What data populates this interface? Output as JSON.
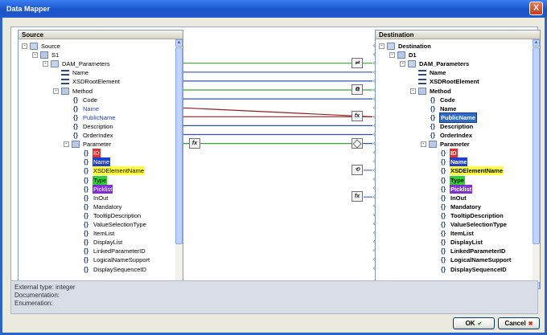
{
  "window": {
    "title": "Data Mapper",
    "close_glyph": "X"
  },
  "source": {
    "header": "Source",
    "nodes": [
      {
        "label": "Source",
        "level": 0,
        "icon": "folder-icon",
        "expander": "-"
      },
      {
        "label": "S1",
        "level": 1,
        "icon": "document-icon",
        "expander": "-"
      },
      {
        "label": "DAM_Parameters",
        "level": 2,
        "icon": "folder-icon",
        "expander": "-"
      },
      {
        "label": "Name",
        "level": 3,
        "icon": "field-icon",
        "expander": ""
      },
      {
        "label": "XSDRootElement",
        "level": 3,
        "icon": "field-icon",
        "expander": ""
      },
      {
        "label": "Method",
        "level": 3,
        "icon": "document-icon",
        "expander": "-"
      },
      {
        "label": "Code",
        "level": 4,
        "icon": "brace-icon",
        "expander": ""
      },
      {
        "label": "Name",
        "level": 4,
        "icon": "brace-icon",
        "expander": "",
        "style": "c-blue"
      },
      {
        "label": "PublicName",
        "level": 4,
        "icon": "brace-icon",
        "expander": "",
        "style": "c-blue"
      },
      {
        "label": "Description",
        "level": 4,
        "icon": "brace-icon",
        "expander": ""
      },
      {
        "label": "OrderIndex",
        "level": 4,
        "icon": "brace-icon",
        "expander": ""
      },
      {
        "label": "Parameter",
        "level": 4,
        "icon": "document-icon",
        "expander": "-"
      },
      {
        "label": "ID",
        "level": 5,
        "icon": "brace-icon",
        "expander": "",
        "style": "hl-red"
      },
      {
        "label": "Name",
        "level": 5,
        "icon": "brace-icon",
        "expander": "",
        "style": "hl-blue"
      },
      {
        "label": "XSDElementName",
        "level": 5,
        "icon": "brace-icon",
        "expander": "",
        "style": "hl-yellow"
      },
      {
        "label": "Type",
        "level": 5,
        "icon": "brace-icon",
        "expander": "",
        "style": "hl-green"
      },
      {
        "label": "Picklist",
        "level": 5,
        "icon": "brace-icon",
        "expander": "",
        "style": "hl-purple"
      },
      {
        "label": "InOut",
        "level": 5,
        "icon": "brace-icon",
        "expander": ""
      },
      {
        "label": "Mandatory",
        "level": 5,
        "icon": "brace-icon",
        "expander": ""
      },
      {
        "label": "TooltipDescription",
        "level": 5,
        "icon": "brace-icon",
        "expander": ""
      },
      {
        "label": "ValueSelectionType",
        "level": 5,
        "icon": "brace-icon",
        "expander": ""
      },
      {
        "label": "ItemList",
        "level": 5,
        "icon": "brace-icon",
        "expander": ""
      },
      {
        "label": "DisplayList",
        "level": 5,
        "icon": "brace-icon",
        "expander": ""
      },
      {
        "label": "LinkedParameterID",
        "level": 5,
        "icon": "brace-icon",
        "expander": ""
      },
      {
        "label": "LogicalNameSupport",
        "level": 5,
        "icon": "brace-icon",
        "expander": ""
      },
      {
        "label": "DisplaySequenceID",
        "level": 5,
        "icon": "brace-icon",
        "expander": ""
      }
    ]
  },
  "destination": {
    "header": "Destination",
    "nodes": [
      {
        "label": "Destination",
        "level": 0,
        "icon": "folder-icon",
        "expander": "-"
      },
      {
        "label": "D1",
        "level": 1,
        "icon": "document-icon",
        "expander": "-"
      },
      {
        "label": "DAM_Parameters",
        "level": 2,
        "icon": "folder-icon",
        "expander": "-"
      },
      {
        "label": "Name",
        "level": 3,
        "icon": "field-icon",
        "expander": ""
      },
      {
        "label": "XSDRootElement",
        "level": 3,
        "icon": "field-icon",
        "expander": ""
      },
      {
        "label": "Method",
        "level": 3,
        "icon": "document-icon",
        "expander": "-"
      },
      {
        "label": "Code",
        "level": 4,
        "icon": "brace-icon",
        "expander": ""
      },
      {
        "label": "Name",
        "level": 4,
        "icon": "brace-icon",
        "expander": ""
      },
      {
        "label": "PublicName",
        "level": 4,
        "icon": "brace-icon",
        "expander": "",
        "style": "hl-sel"
      },
      {
        "label": "Description",
        "level": 4,
        "icon": "brace-icon",
        "expander": ""
      },
      {
        "label": "OrderIndex",
        "level": 4,
        "icon": "brace-icon",
        "expander": ""
      },
      {
        "label": "Parameter",
        "level": 4,
        "icon": "document-icon",
        "expander": "-"
      },
      {
        "label": "ID",
        "level": 5,
        "icon": "brace-icon",
        "expander": "",
        "style": "hl-red"
      },
      {
        "label": "Name",
        "level": 5,
        "icon": "brace-icon",
        "expander": "",
        "style": "hl-blue"
      },
      {
        "label": "XSDElementName",
        "level": 5,
        "icon": "brace-icon",
        "expander": "",
        "style": "hl-yellow"
      },
      {
        "label": "Type",
        "level": 5,
        "icon": "brace-icon",
        "expander": "",
        "style": "hl-green"
      },
      {
        "label": "Picklist",
        "level": 5,
        "icon": "brace-icon",
        "expander": "",
        "style": "hl-purple"
      },
      {
        "label": "InOut",
        "level": 5,
        "icon": "brace-icon",
        "expander": ""
      },
      {
        "label": "Mandatory",
        "level": 5,
        "icon": "brace-icon",
        "expander": ""
      },
      {
        "label": "TooltipDescription",
        "level": 5,
        "icon": "brace-icon",
        "expander": ""
      },
      {
        "label": "ValueSelectionType",
        "level": 5,
        "icon": "brace-icon",
        "expander": ""
      },
      {
        "label": "ItemList",
        "level": 5,
        "icon": "brace-icon",
        "expander": ""
      },
      {
        "label": "DisplayList",
        "level": 5,
        "icon": "brace-icon",
        "expander": ""
      },
      {
        "label": "LinkedParameterID",
        "level": 5,
        "icon": "brace-icon",
        "expander": ""
      },
      {
        "label": "LogicalNameSupport",
        "level": 5,
        "icon": "brace-icon",
        "expander": ""
      },
      {
        "label": "DisplaySequenceID",
        "level": 5,
        "icon": "brace-icon",
        "expander": ""
      }
    ]
  },
  "mappings": [
    {
      "from": 2,
      "to": 2,
      "color": "#3aa43a",
      "function": "transform-icon"
    },
    {
      "from": 3,
      "to": 3,
      "color": "#3050b8",
      "function": ""
    },
    {
      "from": 4,
      "to": 4,
      "color": "#3050b8",
      "function": ""
    },
    {
      "from": 5,
      "to": 5,
      "color": "#3aa43a",
      "function": "copy-icon"
    },
    {
      "from": 6,
      "to": 6,
      "color": "#3050b8",
      "function": ""
    },
    {
      "from": 7,
      "to": 8,
      "color": "#902020",
      "function": "function-fx-icon"
    },
    {
      "from": 8,
      "to": 8,
      "color": "#902020",
      "function": ""
    },
    {
      "from": 9,
      "to": 9,
      "color": "#3050b8",
      "function": ""
    },
    {
      "from": 10,
      "to": 10,
      "color": "#3050b8",
      "function": ""
    },
    {
      "from": 11,
      "to": 11,
      "color": "#3aa43a",
      "function": "function-fx-icon"
    }
  ],
  "function_labels": {
    "fx": "fx"
  },
  "info": {
    "external_type": "External type: integer",
    "documentation": "Documentation:",
    "enumeration": "Enumeration:"
  },
  "buttons": {
    "ok": "OK",
    "cancel": "Cancel"
  }
}
